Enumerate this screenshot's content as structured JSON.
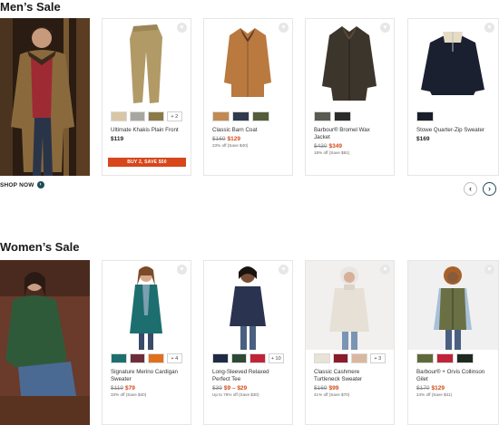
{
  "mens": {
    "title": "Men’s Sale",
    "shop_now": "SHOP NOW",
    "promo_label": "BUY 2, SAVE $50",
    "products": [
      {
        "name": "Ultimate Khakis Plain Front",
        "price": "$119",
        "old_price": "",
        "sale_price": "",
        "savings": "",
        "swatches": [
          "#d8c7a5",
          "#a7a7a0",
          "#8a7a48"
        ],
        "more": "+ 2",
        "image_icon": "khaki-pants-icon"
      },
      {
        "name": "Classic Barn Coat",
        "price": "",
        "old_price": "$169",
        "sale_price": "$129",
        "savings": "23% off (Save $40)",
        "swatches": [
          "#c28a52",
          "#2f3b4c",
          "#545c3a"
        ],
        "more": "",
        "image_icon": "barn-coat-icon"
      },
      {
        "name": "Barbour® Bromel Wax Jacket",
        "price": "",
        "old_price": "$430",
        "sale_price": "$349",
        "savings": "18% off (Save $81)",
        "swatches": [
          "#5a5a52",
          "#2b2b2b"
        ],
        "more": "",
        "image_icon": "wax-jacket-icon"
      },
      {
        "name": "Stowe Quarter-Zip Sweater",
        "price": "$169",
        "old_price": "",
        "sale_price": "",
        "savings": "",
        "swatches": [
          "#1a1e2a"
        ],
        "more": "",
        "image_icon": "quarter-zip-sweater-icon"
      }
    ]
  },
  "womens": {
    "title": "Women’s Sale",
    "products": [
      {
        "name": "Signature Merino Cardigan Sweater",
        "price": "",
        "old_price": "$119",
        "sale_price": "$79",
        "savings": "33% off (Save $40)",
        "swatches": [
          "#1d6f6f",
          "#6d2e3a",
          "#e0701e"
        ],
        "more": "+ 4",
        "image_icon": "cardigan-icon"
      },
      {
        "name": "Long-Sleeved Relaxed Perfect Tee",
        "price": "",
        "old_price": "$39",
        "sale_price": "$9 – $29",
        "savings": "Up to 76% off (Save $30)",
        "swatches": [
          "#1f2a44",
          "#2c4a36",
          "#c0243a"
        ],
        "more": "+ 10",
        "image_icon": "long-sleeve-tee-icon"
      },
      {
        "name": "Classic Cashmere Turtleneck Sweater",
        "price": "",
        "old_price": "$169",
        "sale_price": "$99",
        "savings": "41% off (Save $70)",
        "swatches": [
          "#e9e2d6",
          "#8a1c2b",
          "#d9b7a0"
        ],
        "more": "+ 3",
        "image_icon": "turtleneck-icon"
      },
      {
        "name": "Barbour® + Orvis Collinson Gilet",
        "price": "",
        "old_price": "$170",
        "sale_price": "$129",
        "savings": "24% off (Save $41)",
        "swatches": [
          "#5f6a3a",
          "#c0243a",
          "#1f2a20"
        ],
        "more": "",
        "image_icon": "quilted-vest-icon"
      }
    ]
  },
  "carousel": {
    "prev": "‹",
    "next": "›"
  },
  "fav_icon": "♥",
  "colors": {
    "accent": "#1f4b5a",
    "sale": "#d34a16",
    "promo": "#d6471b"
  }
}
